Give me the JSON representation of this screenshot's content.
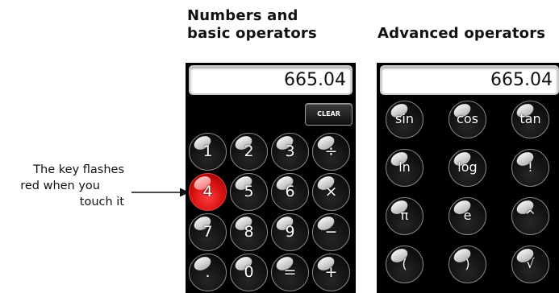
{
  "headings": {
    "basic": [
      "Numbers and",
      "basic operators"
    ],
    "advanced": "Advanced operators"
  },
  "annotation": {
    "lines": [
      "The key flashes",
      "red when you",
      "touch it"
    ]
  },
  "basic_calculator": {
    "display_value": "665.04",
    "clear_label": "CLEAR",
    "keys": [
      {
        "label": "1",
        "name": "key-1"
      },
      {
        "label": "2",
        "name": "key-2"
      },
      {
        "label": "3",
        "name": "key-3"
      },
      {
        "label": "÷",
        "name": "key-divide"
      },
      {
        "label": "4",
        "name": "key-4",
        "state": "pressed"
      },
      {
        "label": "5",
        "name": "key-5"
      },
      {
        "label": "6",
        "name": "key-6"
      },
      {
        "label": "×",
        "name": "key-multiply"
      },
      {
        "label": "7",
        "name": "key-7"
      },
      {
        "label": "8",
        "name": "key-8"
      },
      {
        "label": "9",
        "name": "key-9"
      },
      {
        "label": "−",
        "name": "key-minus"
      },
      {
        "label": ".",
        "name": "key-decimal"
      },
      {
        "label": "0",
        "name": "key-0"
      },
      {
        "label": "=",
        "name": "key-equals"
      },
      {
        "label": "+",
        "name": "key-plus"
      }
    ]
  },
  "advanced_calculator": {
    "display_value": "665.04",
    "keys": [
      {
        "label": "sin",
        "name": "key-sin"
      },
      {
        "label": "cos",
        "name": "key-cos"
      },
      {
        "label": "tan",
        "name": "key-tan"
      },
      {
        "label": "ln",
        "name": "key-ln"
      },
      {
        "label": "log",
        "name": "key-log"
      },
      {
        "label": "!",
        "name": "key-factorial"
      },
      {
        "label": "π",
        "name": "key-pi"
      },
      {
        "label": "e",
        "name": "key-e"
      },
      {
        "label": "^",
        "name": "key-power"
      },
      {
        "label": "(",
        "name": "key-open-paren"
      },
      {
        "label": ")",
        "name": "key-close-paren"
      },
      {
        "label": "√",
        "name": "key-sqrt"
      }
    ]
  },
  "colors": {
    "panel_background": "#000000",
    "pressed_key": "#d20f0f",
    "display_background": "#ffffff"
  }
}
